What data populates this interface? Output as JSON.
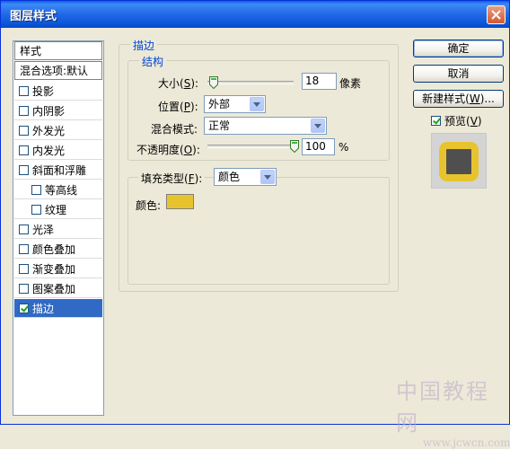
{
  "window": {
    "title": "图层样式"
  },
  "left_panel": {
    "items": [
      {
        "label": "样式",
        "checkbox": false,
        "checked": false,
        "selected": false,
        "indent": false,
        "header": true
      },
      {
        "label": "混合选项:默认",
        "checkbox": false,
        "checked": false,
        "selected": false,
        "indent": false,
        "header": true
      },
      {
        "label": "投影",
        "checkbox": true,
        "checked": false,
        "selected": false,
        "indent": false
      },
      {
        "label": "内阴影",
        "checkbox": true,
        "checked": false,
        "selected": false,
        "indent": false
      },
      {
        "label": "外发光",
        "checkbox": true,
        "checked": false,
        "selected": false,
        "indent": false
      },
      {
        "label": "内发光",
        "checkbox": true,
        "checked": false,
        "selected": false,
        "indent": false
      },
      {
        "label": "斜面和浮雕",
        "checkbox": true,
        "checked": false,
        "selected": false,
        "indent": false
      },
      {
        "label": "等高线",
        "checkbox": true,
        "checked": false,
        "selected": false,
        "indent": true
      },
      {
        "label": "纹理",
        "checkbox": true,
        "checked": false,
        "selected": false,
        "indent": true
      },
      {
        "label": "光泽",
        "checkbox": true,
        "checked": false,
        "selected": false,
        "indent": false
      },
      {
        "label": "颜色叠加",
        "checkbox": true,
        "checked": false,
        "selected": false,
        "indent": false
      },
      {
        "label": "渐变叠加",
        "checkbox": true,
        "checked": false,
        "selected": false,
        "indent": false
      },
      {
        "label": "图案叠加",
        "checkbox": true,
        "checked": false,
        "selected": false,
        "indent": false
      },
      {
        "label": "描边",
        "checkbox": true,
        "checked": true,
        "selected": true,
        "indent": false
      }
    ]
  },
  "stroke": {
    "group_title": "描边",
    "structure_title": "结构",
    "size_label": "大小(",
    "size_key": "S",
    "size_suffix": "):",
    "size_value": "18",
    "size_unit": "像素",
    "size_slider_fraction": 0.07,
    "position_label": "位置(",
    "position_key": "P",
    "position_suffix": "):",
    "position_value": "外部",
    "blend_mode_label": "混合模式:",
    "blend_mode_value": "正常",
    "opacity_label": "不透明度(",
    "opacity_key": "O",
    "opacity_suffix": "):",
    "opacity_value": "100",
    "opacity_unit": "%",
    "opacity_slider_fraction": 1.0,
    "fill_type_label": "填充类型(",
    "fill_type_key": "F",
    "fill_type_suffix": "):",
    "fill_type_value": "颜色",
    "color_label": "颜色:",
    "color_value": "#e7c42d"
  },
  "buttons": {
    "ok": "确定",
    "cancel": "取消",
    "new_style_label": "新建样式(",
    "new_style_key": "W",
    "new_style_suffix": ")...",
    "preview_label": "预览(",
    "preview_key": "V",
    "preview_suffix": ")",
    "preview_checked": true
  },
  "preview": {
    "stroke_color": "#e7c42d",
    "fill_color": "#4f4f4f"
  },
  "watermark": {
    "text_main": "中国教程网",
    "text_url": "www.jcwcn.com"
  },
  "colors": {
    "accent": "#316ac5",
    "title_bar": "#0a5fe4",
    "group_label": "#0046d5"
  }
}
